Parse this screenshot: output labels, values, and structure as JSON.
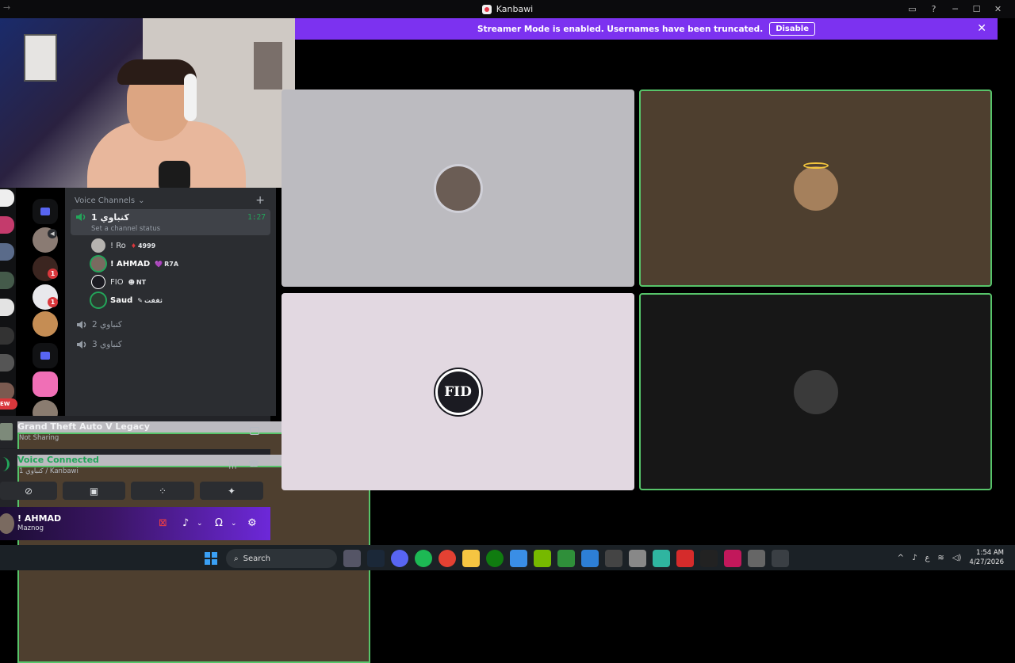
{
  "window": {
    "title": "Kanbawi",
    "back_arrow": "→",
    "controls": [
      "▭",
      "?",
      "─",
      "☐",
      "✕"
    ]
  },
  "banner": {
    "message": "Streamer Mode is enabled. Usernames have been truncated.",
    "button_label": "Disable",
    "close": "✕"
  },
  "channels": {
    "section_title": "Voice Channels",
    "add": "+",
    "active_channel": {
      "name": "1 كنباوي",
      "timer": "1:27",
      "status_placeholder": "Set a channel status"
    },
    "members": [
      {
        "name": "! Ro",
        "tag": "4999",
        "tag_icon": "♦"
      },
      {
        "name": "! AHMAD",
        "tag": "R7A",
        "tag_icon": "💜"
      },
      {
        "name": "FIO",
        "tag": "NT",
        "tag_icon": "☻"
      },
      {
        "name": "Saud",
        "tag": "ثقفت",
        "tag_icon": "✎"
      }
    ],
    "other_channels": [
      "2 كنباوي",
      "3 كنباوي"
    ]
  },
  "dm_badges": [
    "1",
    "1"
  ],
  "activity": {
    "game": "Grand Theft Auto V Legacy",
    "status": "Not Sharing"
  },
  "voice": {
    "status": "Voice Connected",
    "location": "1 كنباوي / Kanbawi"
  },
  "user": {
    "name": "! AHMAD",
    "status": "Maznog"
  },
  "tiles": {
    "fio_logo": "FID"
  },
  "taskbar": {
    "search_placeholder": "Search",
    "clock_time": "1:54 AM",
    "clock_date": "4/27/2026",
    "lang": "ع"
  },
  "colors": {
    "banner": "#7c32f0",
    "connected": "#23a55a",
    "speaking_border": "#57c46a"
  }
}
